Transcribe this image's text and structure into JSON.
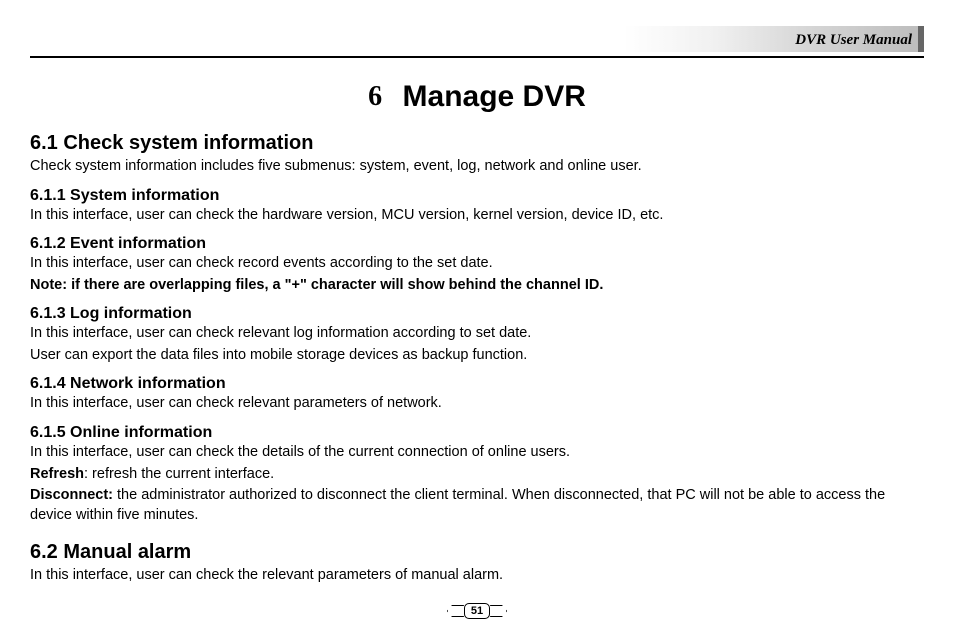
{
  "header": {
    "manual_title": "DVR User Manual"
  },
  "chapter": {
    "number": "6",
    "title": "Manage DVR"
  },
  "s61": {
    "heading": "6.1  Check system information",
    "body": "Check system information includes five submenus: system, event, log, network and online user."
  },
  "s611": {
    "heading": "6.1.1  System information",
    "body": "In this interface, user can check the hardware version, MCU version, kernel version, device ID, etc."
  },
  "s612": {
    "heading": "6.1.2  Event information",
    "body": "In this interface, user can check record events according to the set date.",
    "note": "Note: if there are overlapping files, a \"+\" character will show behind the channel ID."
  },
  "s613": {
    "heading": "6.1.3  Log information",
    "body1": "In this interface, user can check relevant log information according to set date.",
    "body2": "User can export the data files into mobile storage devices as backup function."
  },
  "s614": {
    "heading": "6.1.4  Network information",
    "body": "In this interface, user can check relevant parameters of network."
  },
  "s615": {
    "heading": "6.1.5  Online information",
    "body": "In this interface, user can check the details of the current connection of online users.",
    "refresh_label": "Refresh",
    "refresh_text": ": refresh the current interface.",
    "disconnect_label": "Disconnect:",
    "disconnect_text": " the administrator authorized to disconnect the client terminal. When disconnected, that PC will not be able to access the device within five minutes."
  },
  "s62": {
    "heading": "6.2  Manual alarm",
    "body": "In this interface, user can check the relevant parameters of manual alarm."
  },
  "page_number": "51"
}
